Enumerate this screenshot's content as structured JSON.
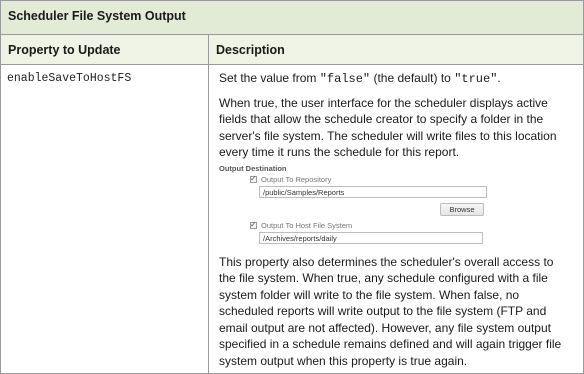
{
  "table": {
    "title": "Scheduler File System Output",
    "headers": {
      "property": "Property to Update",
      "description": "Description"
    },
    "row": {
      "property": "enableSaveToHostFS",
      "desc": {
        "p1_prefix": "Set the value from ",
        "p1_false": "\"false\"",
        "p1_middle": " (the default) to ",
        "p1_true": "\"true\"",
        "p1_suffix": ".",
        "p2": "When true, the user interface for the scheduler displays active fields that allow the schedule creator to specify a folder in the server's file system. The scheduler will write files to this location every time it runs the schedule for this report.",
        "p3": "This property also determines the scheduler's overall access to the file system. When true, any schedule configured with a file system folder will write to the file system. When false, no scheduled reports will write output to the file system (FTP and email output are not affected). However, any file system output specified in a schedule remains defined and will again trigger file system output when this property is true again."
      }
    }
  },
  "embedded_ui": {
    "section_label": "Output Destination",
    "repository": {
      "label": "Output To Repository",
      "checked": true,
      "value": "/public/Samples/Reports"
    },
    "browse_label": "Browse",
    "host_fs": {
      "label": "Output To Host File System",
      "checked": true,
      "value": "/Archives/reports/daily"
    }
  }
}
